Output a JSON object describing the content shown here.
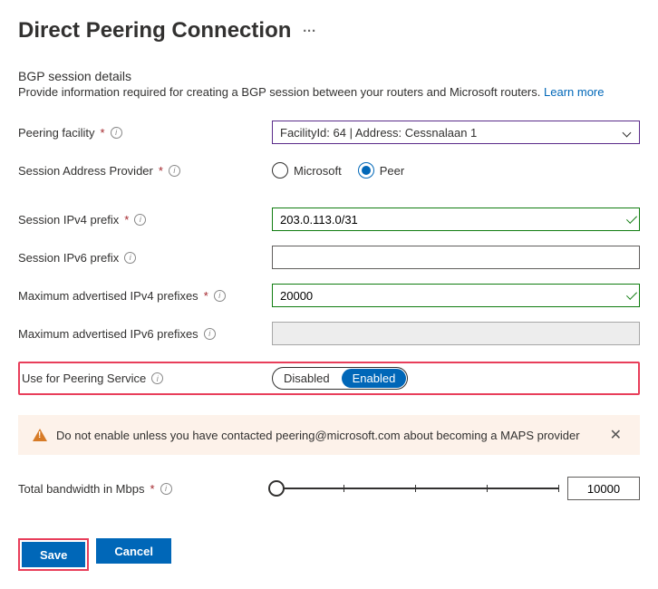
{
  "title": "Direct Peering Connection",
  "section": {
    "heading": "BGP session details",
    "description": "Provide information required for creating a BGP session between your routers and Microsoft routers. ",
    "learn_more": "Learn more"
  },
  "fields": {
    "facility": {
      "label": "Peering facility",
      "value": "FacilityId: 64 | Address: Cessnalaan 1"
    },
    "sap": {
      "label": "Session Address Provider",
      "options": {
        "ms": "Microsoft",
        "peer": "Peer"
      },
      "selected": "peer"
    },
    "ipv4_prefix": {
      "label": "Session IPv4 prefix",
      "value": "203.0.113.0/31"
    },
    "ipv6_prefix": {
      "label": "Session IPv6 prefix",
      "value": ""
    },
    "max_ipv4": {
      "label": "Maximum advertised IPv4 prefixes",
      "value": "20000"
    },
    "max_ipv6": {
      "label": "Maximum advertised IPv6 prefixes",
      "value": ""
    },
    "peering_service": {
      "label": "Use for Peering Service",
      "options": {
        "disabled": "Disabled",
        "enabled": "Enabled"
      },
      "selected": "enabled"
    },
    "bandwidth": {
      "label": "Total bandwidth in Mbps",
      "value": "10000"
    }
  },
  "warning": "Do not enable unless you have contacted peering@microsoft.com about becoming a MAPS provider",
  "buttons": {
    "save": "Save",
    "cancel": "Cancel"
  }
}
